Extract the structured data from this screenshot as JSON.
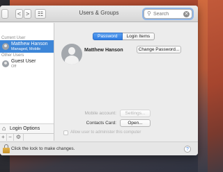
{
  "window": {
    "title": "Users & Groups",
    "nav": {
      "back": "<",
      "forward": ">",
      "grid": "☷"
    }
  },
  "search": {
    "placeholder": "Search",
    "clear_glyph": "✕",
    "icon_glyph": "⚲"
  },
  "sidebar": {
    "current_user_heading": "Current User",
    "other_users_heading": "Other Users",
    "current_user": {
      "name": "Matthew Hanson",
      "subtitle": "Managed, Mobile"
    },
    "other_users": [
      {
        "name": "Guest User",
        "subtitle": "Off"
      }
    ],
    "login_options": "Login Options",
    "tools": {
      "add": "+",
      "remove": "−",
      "action": "⚙"
    }
  },
  "main": {
    "tabs": [
      {
        "label": "Password",
        "active": true
      },
      {
        "label": "Login Items",
        "active": false
      }
    ],
    "account_name": "Matthew Hanson",
    "change_password_button": "Change Password...",
    "mobile_account_label": "Mobile account:",
    "settings_button": "Settings...",
    "contacts_card_label": "Contacts Card:",
    "open_button": "Open...",
    "allow_admin_label": "Allow user to administer this computer"
  },
  "bottom": {
    "lock_text": "Click the lock to make changes.",
    "help": "?"
  },
  "colors": {
    "selection": "#3d86d8",
    "tab_active": "#2f7ce2",
    "lock": "#d4a13c"
  }
}
